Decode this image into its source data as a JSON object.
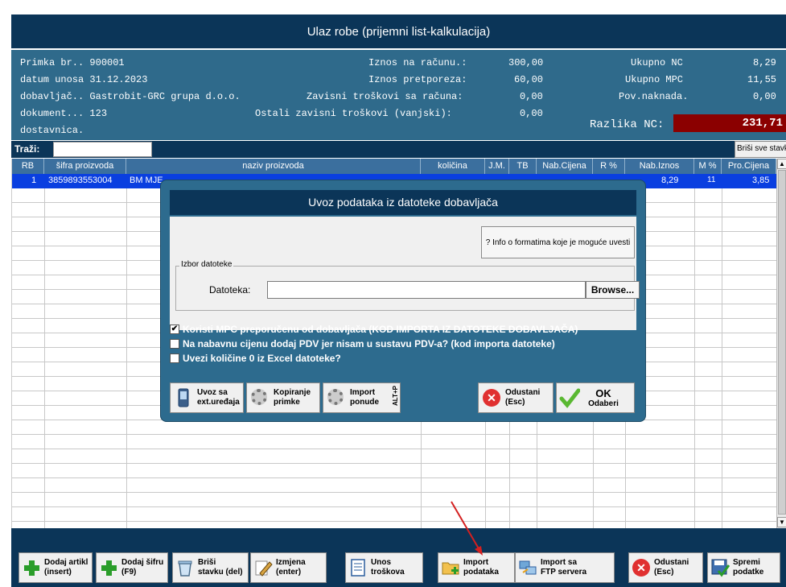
{
  "title": "Ulaz robe (prijemni list-kalkulacija)",
  "info": {
    "primka": "Primka br.. 900001",
    "datum": "datum unosa 31.12.2023",
    "dobavljac": "dobavljač.. Gastrobit-GRC grupa d.o.o.",
    "dokument": "dokument... 123",
    "dostavnica": "dostavnica.",
    "iznos_label": "Iznos na računu.:",
    "iznos_value": "300,00",
    "pretporez_label": "Iznos pretporeza:",
    "pretporez_value": "60,00",
    "zavisni_label": "Zavisni troškovi sa računa:",
    "zavisni_value": "0,00",
    "ostali_label": "Ostali zavisni troškovi (vanjski):",
    "ostali_value": "0,00",
    "ukupno_nc_label": "Ukupno NC",
    "ukupno_nc_value": "8,29",
    "ukupno_mpc_label": "Ukupno MPC",
    "ukupno_mpc_value": "11,55",
    "pov_label": "Pov.naknada.",
    "pov_value": "0,00",
    "razlika_label": "Razlika NC:",
    "razlika_value": "231,71",
    "razlika_color": "#8b0000"
  },
  "search": {
    "label": "Traži:",
    "value": "",
    "delete_all": "Briši sve stavke"
  },
  "table": {
    "headers": [
      "RB",
      "šifra proizvoda",
      "naziv proizvoda",
      "količina",
      "J.M.",
      "TB",
      "Nab.Cijena",
      "R %",
      "Nab.Iznos",
      "M %",
      "Pro.Cijena"
    ],
    "rows": [
      {
        "rb": "1",
        "sifra": "3859893553004",
        "naziv": "BM MJE",
        "nab_iznos": "8,29",
        "m": "11",
        "pro_cijena": "3,85"
      }
    ],
    "selected_color": "#0a3fe0"
  },
  "dialog": {
    "title": "Uvoz podataka iz datoteke dobavljača",
    "info_button": "? Info o formatima koje je moguće uvesti",
    "group_title": "Izbor datoteke",
    "file_label": "Datoteka:",
    "file_value": "",
    "browse": "Browse...",
    "checkboxes": [
      {
        "label": "Koristi MPC preporučenu od dobavljača (KOD IMPORTA IZ DATOTEKE DOBAVLJAČA)",
        "checked": true
      },
      {
        "label": "Na nabavnu cijenu dodaj PDV jer nisam u sustavu PDV-a? (kod importa datoteke)",
        "checked": false
      },
      {
        "label": "Uvezi količine 0 iz Excel datoteke?",
        "checked": false
      }
    ],
    "btn_uvoz": "Uvoz sa\next.uređaja",
    "btn_kopiranje": "Kopiranje\nprimke",
    "btn_import_ponude": "Import\nponude",
    "alt_p": "ALT+P",
    "btn_odustani": "Odustani\n(Esc)",
    "btn_ok": "OK",
    "btn_odaberi": "Odaberi"
  },
  "bottom": {
    "dodaj_artikl": "Dodaj artikl\n(insert)",
    "dodaj_sifru": "Dodaj šifru\n(F9)",
    "brisi": "Briši\nstavku (del)",
    "izmjena": "Izmjena\n(enter)",
    "unos": "Unos\ntroškova",
    "import_podataka": "Import\npodataka",
    "import_ftp": "Import sa\nFTP servera",
    "odustani": "Odustani\n(Esc)",
    "spremi": "Spremi\npodatke"
  },
  "icons": {
    "add": "plus-icon",
    "delete": "trash-icon",
    "edit": "pencil-icon",
    "costs": "document-icon",
    "import": "folder-import-icon",
    "ftp": "network-icon",
    "cancel": "cancel-icon",
    "save": "save-icon",
    "device": "device-icon",
    "gear": "gear-icon",
    "ok": "checkmark-icon"
  }
}
